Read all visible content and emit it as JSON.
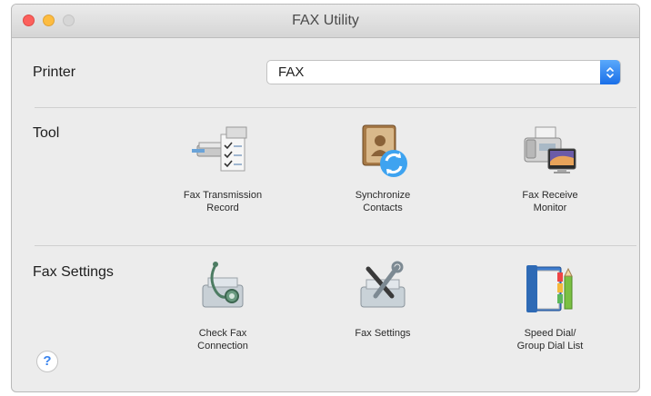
{
  "window": {
    "title": "FAX Utility"
  },
  "printer": {
    "label": "Printer",
    "selected": "FAX"
  },
  "sections": {
    "tool_label": "Tool",
    "fax_settings_label": "Fax Settings"
  },
  "tools": [
    {
      "label": "Fax Transmission\nRecord",
      "icon": "fax-transmission-record-icon"
    },
    {
      "label": "Synchronize\nContacts",
      "icon": "synchronize-contacts-icon"
    },
    {
      "label": "Fax Receive\nMonitor",
      "icon": "fax-receive-monitor-icon"
    }
  ],
  "fax_settings": [
    {
      "label": "Check Fax\nConnection",
      "icon": "check-fax-connection-icon"
    },
    {
      "label": "Fax Settings",
      "icon": "fax-settings-icon"
    },
    {
      "label": "Speed Dial/\nGroup Dial List",
      "icon": "speed-dial-list-icon"
    }
  ],
  "help": {
    "glyph": "?"
  }
}
